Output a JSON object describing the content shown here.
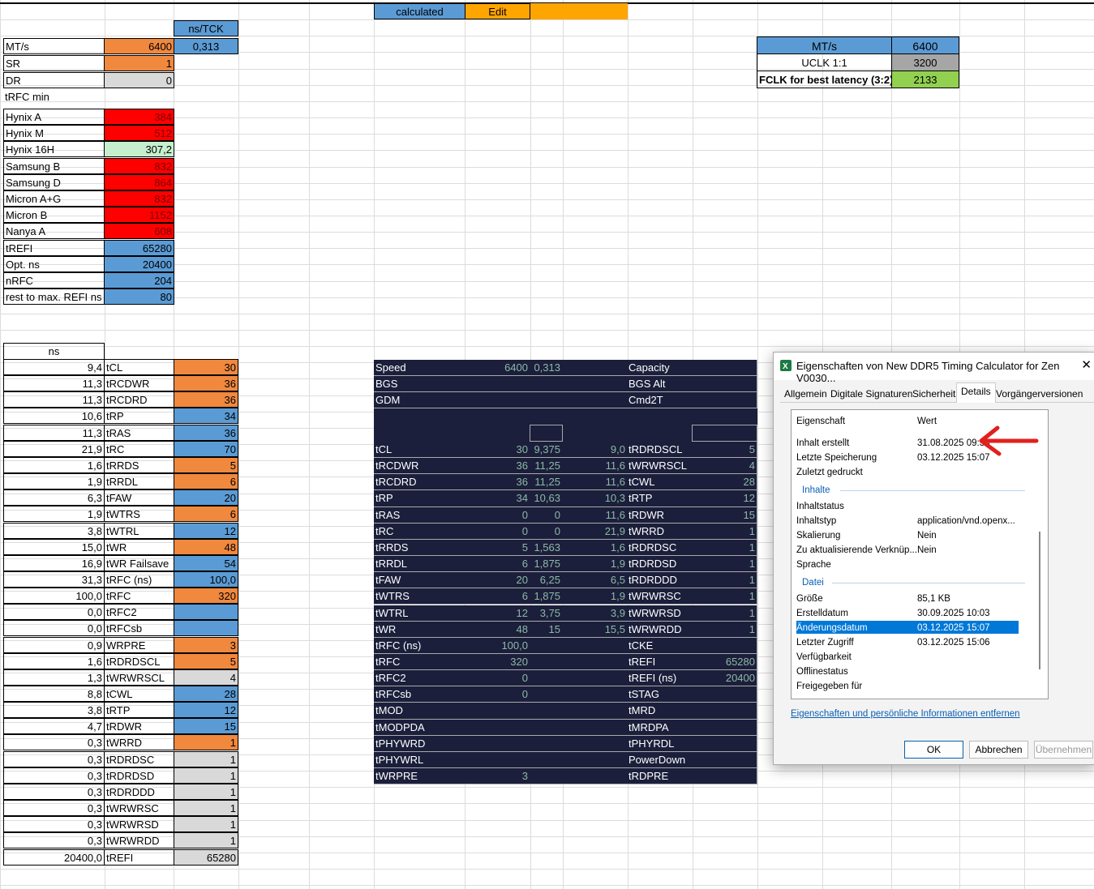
{
  "top_header": {
    "calculated_label": "calculated",
    "edit_label": "Edit"
  },
  "ns_tck_label": "ns/TCK",
  "left_params": [
    {
      "label": "MT/s",
      "value": "6400",
      "extra": "0,313"
    },
    {
      "label": "SR",
      "value": "1"
    },
    {
      "label": "DR",
      "value": "0"
    },
    {
      "label": "tRFC min"
    }
  ],
  "trfc_table": [
    {
      "label": "Hynix A",
      "value": "384"
    },
    {
      "label": "Hynix M",
      "value": "512"
    },
    {
      "label": "Hynix 16H",
      "value": "307,2"
    },
    {
      "label": "Samsung B",
      "value": "832"
    },
    {
      "label": "Samsung D",
      "value": "864"
    },
    {
      "label": "Micron A+G",
      "value": "832"
    },
    {
      "label": "Micron B",
      "value": "1152"
    },
    {
      "label": "Nanya A",
      "value": "608"
    },
    {
      "label": "tREFI",
      "value": "65280"
    },
    {
      "label": "Opt. ns",
      "value": "20400"
    },
    {
      "label": "nRFC",
      "value": "204"
    },
    {
      "label": "rest to max. REFI ns",
      "value": "80"
    }
  ],
  "clock_box": {
    "mts_label": "MT/s",
    "mts_value": "6400",
    "uclk_label": "UCLK 1:1",
    "uclk_value": "3200",
    "fclk_label": "FCLK for best latency (3:2)",
    "fclk_value": "2133"
  },
  "timings_header": "ns",
  "timings": [
    {
      "ns": "9,4",
      "name": "tCL",
      "val": "30",
      "color": "orange"
    },
    {
      "ns": "11,3",
      "name": "tRCDWR",
      "val": "36",
      "color": "orange"
    },
    {
      "ns": "11,3",
      "name": "tRCDRD",
      "val": "36",
      "color": "orange"
    },
    {
      "ns": "10,6",
      "name": "tRP",
      "val": "34",
      "color": "blue"
    },
    {
      "ns": "11,3",
      "name": "tRAS",
      "val": "36",
      "color": "blue"
    },
    {
      "ns": "21,9",
      "name": "tRC",
      "val": "70",
      "color": "blue"
    },
    {
      "ns": "1,6",
      "name": "tRRDS",
      "val": "5",
      "color": "orange"
    },
    {
      "ns": "1,9",
      "name": "tRRDL",
      "val": "6",
      "color": "orange"
    },
    {
      "ns": "6,3",
      "name": "tFAW",
      "val": "20",
      "color": "blue"
    },
    {
      "ns": "1,9",
      "name": "tWTRS",
      "val": "6",
      "color": "orange"
    },
    {
      "ns": "3,8",
      "name": "tWTRL",
      "val": "12",
      "color": "blue"
    },
    {
      "ns": "15,0",
      "name": "tWR",
      "val": "48",
      "color": "orange"
    },
    {
      "ns": "16,9",
      "name": "tWR Failsave",
      "val": "54",
      "color": "blue"
    },
    {
      "ns": "31,3",
      "name": "tRFC (ns)",
      "val": "100,0",
      "color": "blue"
    },
    {
      "ns": "100,0",
      "name": "tRFC",
      "val": "320",
      "color": "orange"
    },
    {
      "ns": "0,0",
      "name": "tRFC2",
      "val": "",
      "color": "blue"
    },
    {
      "ns": "0,0",
      "name": "tRFCsb",
      "val": "",
      "color": "blue"
    },
    {
      "ns": "0,9",
      "name": "WRPRE",
      "val": "3",
      "color": "orange"
    },
    {
      "ns": "1,6",
      "name": "tRDRDSCL",
      "val": "5",
      "color": "orange"
    },
    {
      "ns": "1,3",
      "name": "tWRWRSCL",
      "val": "4",
      "color": "grey"
    },
    {
      "ns": "8,8",
      "name": "tCWL",
      "val": "28",
      "color": "blue"
    },
    {
      "ns": "3,8",
      "name": "tRTP",
      "val": "12",
      "color": "blue"
    },
    {
      "ns": "4,7",
      "name": "tRDWR",
      "val": "15",
      "color": "blue"
    },
    {
      "ns": "0,3",
      "name": "tWRRD",
      "val": "1",
      "color": "orange"
    },
    {
      "ns": "0,3",
      "name": "tRDRDSC",
      "val": "1",
      "color": "grey"
    },
    {
      "ns": "0,3",
      "name": "tRDRDSD",
      "val": "1",
      "color": "grey"
    },
    {
      "ns": "0,3",
      "name": "tRDRDDD",
      "val": "1",
      "color": "grey"
    },
    {
      "ns": "0,3",
      "name": "tWRWRSC",
      "val": "1",
      "color": "grey"
    },
    {
      "ns": "0,3",
      "name": "tWRWRSD",
      "val": "1",
      "color": "grey"
    },
    {
      "ns": "0,3",
      "name": "tWRWRDD",
      "val": "1",
      "color": "grey"
    },
    {
      "ns": "20400,0",
      "name": "tREFI",
      "val": "65280",
      "color": "grey"
    }
  ],
  "dark_top": [
    {
      "a": "Speed",
      "b": "6400",
      "c": "0,313",
      "d": "",
      "e": "Capacity",
      "f": ""
    },
    {
      "a": "BGS",
      "b": "",
      "c": "",
      "d": "",
      "e": "BGS Alt",
      "f": ""
    },
    {
      "a": "GDM",
      "b": "",
      "c": "",
      "d": "",
      "e": "Cmd2T",
      "f": ""
    }
  ],
  "dark_rows": [
    {
      "a": "tCL",
      "b": "30",
      "c": "9,375",
      "d": "9,0",
      "e": "tRDRDSCL",
      "f": "5"
    },
    {
      "a": "tRCDWR",
      "b": "36",
      "c": "11,25",
      "d": "11,6",
      "e": "tWRWRSCL",
      "f": "4"
    },
    {
      "a": "tRCDRD",
      "b": "36",
      "c": "11,25",
      "d": "11,6",
      "e": "tCWL",
      "f": "28"
    },
    {
      "a": "tRP",
      "b": "34",
      "c": "10,63",
      "d": "10,3",
      "e": "tRTP",
      "f": "12"
    },
    {
      "a": "tRAS",
      "b": "0",
      "c": "0",
      "d": "11,6",
      "e": "tRDWR",
      "f": "15"
    },
    {
      "a": "tRC",
      "b": "0",
      "c": "0",
      "d": "21,9",
      "e": "tWRRD",
      "f": "1"
    },
    {
      "a": "tRRDS",
      "b": "5",
      "c": "1,563",
      "d": "1,6",
      "e": "tRDRDSC",
      "f": "1"
    },
    {
      "a": "tRRDL",
      "b": "6",
      "c": "1,875",
      "d": "1,9",
      "e": "tRDRDSD",
      "f": "1"
    },
    {
      "a": "tFAW",
      "b": "20",
      "c": "6,25",
      "d": "6,5",
      "e": "tRDRDDD",
      "f": "1"
    },
    {
      "a": "tWTRS",
      "b": "6",
      "c": "1,875",
      "d": "1,9",
      "e": "tWRWRSC",
      "f": "1"
    },
    {
      "a": "tWTRL",
      "b": "12",
      "c": "3,75",
      "d": "3,9",
      "e": "tWRWRSD",
      "f": "1"
    },
    {
      "a": "tWR",
      "b": "48",
      "c": "15",
      "d": "15,5",
      "e": "tWRWRDD",
      "f": "1"
    },
    {
      "a": "tRFC (ns)",
      "b": "100,0",
      "c": "",
      "d": "",
      "e": "tCKE",
      "f": ""
    },
    {
      "a": "tRFC",
      "b": "320",
      "c": "",
      "d": "",
      "e": "tREFI",
      "f": "65280"
    },
    {
      "a": "tRFC2",
      "b": "0",
      "c": "",
      "d": "",
      "e": "tREFI (ns)",
      "f": "20400"
    },
    {
      "a": "tRFCsb",
      "b": "0",
      "c": "",
      "d": "",
      "e": "tSTAG",
      "f": ""
    },
    {
      "a": "tMOD",
      "b": "",
      "c": "",
      "d": "",
      "e": "tMRD",
      "f": ""
    },
    {
      "a": "tMODPDA",
      "b": "",
      "c": "",
      "d": "",
      "e": "tMRDPA",
      "f": ""
    },
    {
      "a": "tPHYWRD",
      "b": "",
      "c": "",
      "d": "",
      "e": "tPHYRDL",
      "f": ""
    },
    {
      "a": "tPHYWRL",
      "b": "",
      "c": "",
      "d": "",
      "e": "PowerDown",
      "f": ""
    },
    {
      "a": "tWRPRE",
      "b": "3",
      "c": "",
      "d": "",
      "e": "tRDPRE",
      "f": ""
    }
  ],
  "dialog": {
    "title": "Eigenschaften von New DDR5 Timing Calculator for Zen V0030...",
    "close": "✕",
    "tabs": [
      "Allgemein",
      "Digitale Signaturen",
      "Sicherheit",
      "Details",
      "Vorgängerversionen"
    ],
    "col_property": "Eigenschaft",
    "col_value": "Wert",
    "rows_top": [
      {
        "k": "Inhalt erstellt",
        "v": "31.08.2025 09:35"
      },
      {
        "k": "Letzte Speicherung",
        "v": "03.12.2025 15:07"
      },
      {
        "k": "Zuletzt gedruckt",
        "v": ""
      }
    ],
    "section_content": "Inhalte",
    "rows_content": [
      {
        "k": "Inhaltstatus",
        "v": ""
      },
      {
        "k": "Inhaltstyp",
        "v": "application/vnd.openx..."
      },
      {
        "k": "Skalierung",
        "v": "Nein"
      },
      {
        "k": "Zu aktualisierende Verknüp...",
        "v": "Nein"
      },
      {
        "k": "Sprache",
        "v": ""
      }
    ],
    "section_file": "Datei",
    "rows_file": [
      {
        "k": "Größe",
        "v": "85,1 KB"
      },
      {
        "k": "Erstelldatum",
        "v": "30.09.2025 10:03"
      },
      {
        "k": "Änderungsdatum",
        "v": "03.12.2025 15:07",
        "selected": true
      },
      {
        "k": "Letzter Zugriff",
        "v": "03.12.2025 15:06"
      },
      {
        "k": "Verfügbarkeit",
        "v": ""
      },
      {
        "k": "Offlinestatus",
        "v": ""
      },
      {
        "k": "Freigegeben für",
        "v": ""
      }
    ],
    "remove_link": "Eigenschaften und persönliche Informationen entfernen",
    "ok": "OK",
    "cancel": "Abbrechen",
    "apply": "Übernehmen"
  },
  "colors": {
    "orange": "#f0883e",
    "blue": "#5b9bd5",
    "grey": "#d9d9d9",
    "red": "#ff0000",
    "dark": "#1b1f3b",
    "arrow": "#e0201c"
  }
}
